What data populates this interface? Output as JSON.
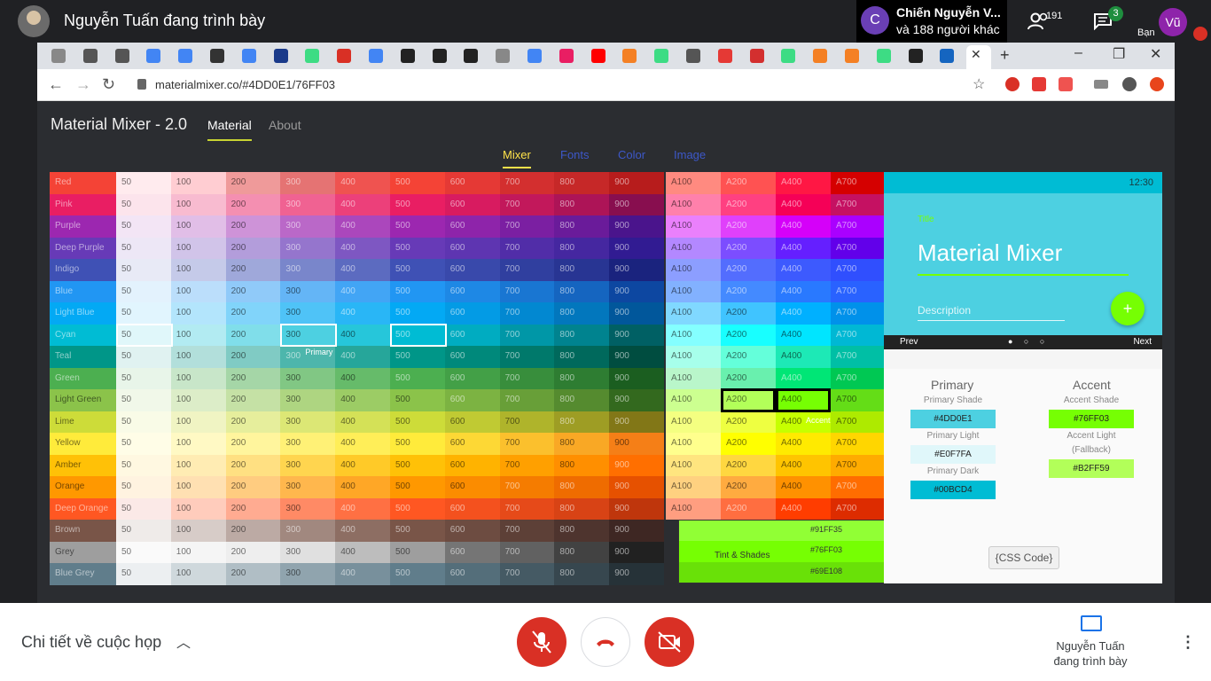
{
  "meet": {
    "presenter_title": "Nguyễn Tuấn đang trình bày",
    "participant_initial": "C",
    "participant_name": "Chiến Nguyễn V...",
    "participant_more": "và 188 người khác",
    "people_count": "191",
    "chat_badge": "3",
    "me_initial": "Vũ",
    "me_label": "Bạn",
    "meeting_details": "Chi tiết về cuộc họp",
    "presenting_label_1": "Nguyễn Tuấn",
    "presenting_label_2": "đang trình bày"
  },
  "browser": {
    "url": "materialmixer.co/#4DD0E1/76FF03"
  },
  "app": {
    "title": "Material Mixer - 2.0",
    "nav_material": "Material",
    "nav_about": "About",
    "subtabs": [
      "Mixer",
      "Fonts",
      "Color",
      "Image"
    ],
    "shade_headers": [
      "50",
      "100",
      "200",
      "300",
      "400",
      "500",
      "600",
      "700",
      "800",
      "900"
    ],
    "accent_headers": [
      "A100",
      "A200",
      "A400",
      "A700"
    ],
    "colors": [
      {
        "name": "Red",
        "shades": [
          "#ffebee",
          "#ffcdd2",
          "#ef9a9a",
          "#e57373",
          "#ef5350",
          "#f44336",
          "#e53935",
          "#d32f2f",
          "#c62828",
          "#b71c1c"
        ],
        "accents": [
          "#ff8a80",
          "#ff5252",
          "#ff1744",
          "#d50000"
        ]
      },
      {
        "name": "Pink",
        "shades": [
          "#fce4ec",
          "#f8bbd0",
          "#f48fb1",
          "#f06292",
          "#ec407a",
          "#e91e63",
          "#d81b60",
          "#c2185b",
          "#ad1457",
          "#880e4f"
        ],
        "accents": [
          "#ff80ab",
          "#ff4081",
          "#f50057",
          "#c51162"
        ]
      },
      {
        "name": "Purple",
        "shades": [
          "#f3e5f5",
          "#e1bee7",
          "#ce93d8",
          "#ba68c8",
          "#ab47bc",
          "#9c27b0",
          "#8e24aa",
          "#7b1fa2",
          "#6a1b9a",
          "#4a148c"
        ],
        "accents": [
          "#ea80fc",
          "#e040fb",
          "#d500f9",
          "#aa00ff"
        ]
      },
      {
        "name": "Deep Purple",
        "shades": [
          "#ede7f6",
          "#d1c4e9",
          "#b39ddb",
          "#9575cd",
          "#7e57c2",
          "#673ab7",
          "#5e35b1",
          "#512da8",
          "#4527a0",
          "#311b92"
        ],
        "accents": [
          "#b388ff",
          "#7c4dff",
          "#651fff",
          "#6200ea"
        ]
      },
      {
        "name": "Indigo",
        "shades": [
          "#e8eaf6",
          "#c5cae9",
          "#9fa8da",
          "#7986cb",
          "#5c6bc0",
          "#3f51b5",
          "#3949ab",
          "#303f9f",
          "#283593",
          "#1a237e"
        ],
        "accents": [
          "#8c9eff",
          "#536dfe",
          "#3d5afe",
          "#304ffe"
        ]
      },
      {
        "name": "Blue",
        "shades": [
          "#e3f2fd",
          "#bbdefb",
          "#90caf9",
          "#64b5f6",
          "#42a5f5",
          "#2196f3",
          "#1e88e5",
          "#1976d2",
          "#1565c0",
          "#0d47a1"
        ],
        "accents": [
          "#82b1ff",
          "#448aff",
          "#2979ff",
          "#2962ff"
        ]
      },
      {
        "name": "Light Blue",
        "shades": [
          "#e1f5fe",
          "#b3e5fc",
          "#81d4fa",
          "#4fc3f7",
          "#29b6f6",
          "#03a9f4",
          "#039be5",
          "#0288d1",
          "#0277bd",
          "#01579b"
        ],
        "accents": [
          "#80d8ff",
          "#40c4ff",
          "#00b0ff",
          "#0091ea"
        ]
      },
      {
        "name": "Cyan",
        "shades": [
          "#e0f7fa",
          "#b2ebf2",
          "#80deea",
          "#4dd0e1",
          "#26c6da",
          "#00bcd4",
          "#00acc1",
          "#0097a7",
          "#00838f",
          "#006064"
        ],
        "accents": [
          "#84ffff",
          "#18ffff",
          "#00e5ff",
          "#00b8d4"
        ]
      },
      {
        "name": "Teal",
        "shades": [
          "#e0f2f1",
          "#b2dfdb",
          "#80cbc4",
          "#4db6ac",
          "#26a69a",
          "#009688",
          "#00897b",
          "#00796b",
          "#00695c",
          "#004d40"
        ],
        "accents": [
          "#a7ffeb",
          "#64ffda",
          "#1de9b6",
          "#00bfa5"
        ]
      },
      {
        "name": "Green",
        "shades": [
          "#e8f5e9",
          "#c8e6c9",
          "#a5d6a7",
          "#81c784",
          "#66bb6a",
          "#4caf50",
          "#43a047",
          "#388e3c",
          "#2e7d32",
          "#1b5e20"
        ],
        "accents": [
          "#b9f6ca",
          "#69f0ae",
          "#00e676",
          "#00c853"
        ]
      },
      {
        "name": "Light Green",
        "shades": [
          "#f1f8e9",
          "#dcedc8",
          "#c5e1a5",
          "#aed581",
          "#9ccc65",
          "#8bc34a",
          "#7cb342",
          "#689f38",
          "#558b2f",
          "#33691e"
        ],
        "accents": [
          "#ccff90",
          "#b2ff59",
          "#76ff03",
          "#64dd17"
        ]
      },
      {
        "name": "Lime",
        "shades": [
          "#f9fbe7",
          "#f0f4c3",
          "#e6ee9c",
          "#dce775",
          "#d4e157",
          "#cddc39",
          "#c0ca33",
          "#afb42b",
          "#9e9d24",
          "#827717"
        ],
        "accents": [
          "#f4ff81",
          "#eeff41",
          "#c6ff00",
          "#aeea00"
        ]
      },
      {
        "name": "Yellow",
        "shades": [
          "#fffde7",
          "#fff9c4",
          "#fff59d",
          "#fff176",
          "#ffee58",
          "#ffeb3b",
          "#fdd835",
          "#fbc02d",
          "#f9a825",
          "#f57f17"
        ],
        "accents": [
          "#ffff8d",
          "#ffff00",
          "#ffea00",
          "#ffd600"
        ]
      },
      {
        "name": "Amber",
        "shades": [
          "#fff8e1",
          "#ffecb3",
          "#ffe082",
          "#ffd54f",
          "#ffca28",
          "#ffc107",
          "#ffb300",
          "#ffa000",
          "#ff8f00",
          "#ff6f00"
        ],
        "accents": [
          "#ffe57f",
          "#ffd740",
          "#ffc400",
          "#ffab00"
        ]
      },
      {
        "name": "Orange",
        "shades": [
          "#fff3e0",
          "#ffe0b2",
          "#ffcc80",
          "#ffb74d",
          "#ffa726",
          "#ff9800",
          "#fb8c00",
          "#f57c00",
          "#ef6c00",
          "#e65100"
        ],
        "accents": [
          "#ffd180",
          "#ffab40",
          "#ff9100",
          "#ff6d00"
        ]
      },
      {
        "name": "Deep Orange",
        "shades": [
          "#fbe9e7",
          "#ffccbc",
          "#ffab91",
          "#ff8a65",
          "#ff7043",
          "#ff5722",
          "#f4511e",
          "#e64a19",
          "#d84315",
          "#bf360c"
        ],
        "accents": [
          "#ff9e80",
          "#ff6e40",
          "#ff3d00",
          "#dd2c00"
        ]
      },
      {
        "name": "Brown",
        "shades": [
          "#efebe9",
          "#d7ccc8",
          "#bcaaa4",
          "#a1887f",
          "#8d6e63",
          "#795548",
          "#6d4c41",
          "#5d4037",
          "#4e342e",
          "#3e2723"
        ],
        "accents": []
      },
      {
        "name": "Grey",
        "shades": [
          "#fafafa",
          "#f5f5f5",
          "#eeeeee",
          "#e0e0e0",
          "#bdbdbd",
          "#9e9e9e",
          "#757575",
          "#616161",
          "#424242",
          "#212121"
        ],
        "accents": []
      },
      {
        "name": "Blue Grey",
        "shades": [
          "#eceff1",
          "#cfd8dc",
          "#b0bec5",
          "#90a4ae",
          "#78909c",
          "#607d8b",
          "#546e7a",
          "#455a64",
          "#37474f",
          "#263238"
        ],
        "accents": []
      }
    ],
    "primary_label": "Primary",
    "accent_label": "Accent",
    "tint": {
      "label": "Tint & Shades",
      "hex_top": "#91FF35",
      "hex_mid": "#76FF03",
      "hex_bot": "#69E108"
    },
    "preview": {
      "time": "12:30",
      "title_label": "Title",
      "title": "Material Mixer",
      "description": "Description",
      "fab": "+",
      "prev": "Prev",
      "next": "Next",
      "dots": "● ○ ○"
    },
    "palette": {
      "primary_head": "Primary",
      "primary_shade_label": "Primary Shade",
      "primary_shade": "#4DD0E1",
      "primary_light_label": "Primary Light",
      "primary_light": "#E0F7FA",
      "primary_dark_label": "Primary Dark",
      "primary_dark": "#00BCD4",
      "accent_head": "Accent",
      "accent_shade_label": "Accent Shade",
      "accent_shade": "#76FF03",
      "accent_light_label": "Accent Light",
      "accent_light_sub": "(Fallback)",
      "accent_light": "#B2FF59",
      "css_button": "{CSS Code}"
    }
  }
}
